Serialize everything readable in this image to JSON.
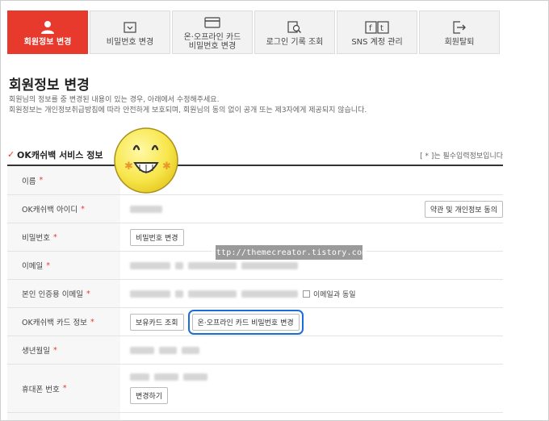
{
  "tabs": [
    {
      "label": "회원정보 변경",
      "icon": "user-icon",
      "active": true
    },
    {
      "label": "비밀번호 변경",
      "icon": "password-icon",
      "active": false
    },
    {
      "label_line1": "온·오프라인 카드",
      "label_line2": "비밀번호 변경",
      "icon": "card-icon",
      "active": false
    },
    {
      "label": "로그인 기록 조회",
      "icon": "login-history-icon",
      "active": false
    },
    {
      "label": "SNS 계정 관리",
      "icon": "sns-icon",
      "active": false
    },
    {
      "label": "회원탈퇴",
      "icon": "logout-icon",
      "active": false
    }
  ],
  "page": {
    "title": "회원정보 변경",
    "desc_line1": "회원님의 정보를 중 변경된 내용이 있는 경우, 아래에서 수정해주세요.",
    "desc_line2": "회원정보는 개인정보취급방침에 따라 안전하게 보호되며, 회원님의 동의 없이 공개 또는 제3자에게 제공되지 않습니다."
  },
  "section": {
    "title": "OK캐쉬백 서비스 정보",
    "required_note": "[ * ]는 필수입력정보입니다"
  },
  "form": {
    "required_mark": "*",
    "name_label": "이름",
    "id_label": "OK캐쉬백 아이디",
    "terms_button": "약관 및 개인정보 동의",
    "password_label": "비밀번호",
    "password_button": "비밀번호 변경",
    "email_label": "이메일",
    "auth_email_label": "본인 인증용 이메일",
    "same_as_email": "이메일과 동일",
    "card_label": "OK캐쉬백 카드 정보",
    "owned_card_button": "보유카드 조회",
    "card_pw_button": "온·오프라인 카드 비밀번호 변경",
    "birth_label": "생년월일",
    "phone_label": "휴대폰 번호",
    "change_button": "변경하기"
  },
  "watermark": "http://themecreator.tistory.com",
  "colors": {
    "accent": "#e8392d",
    "highlight": "#1a6fd6"
  }
}
